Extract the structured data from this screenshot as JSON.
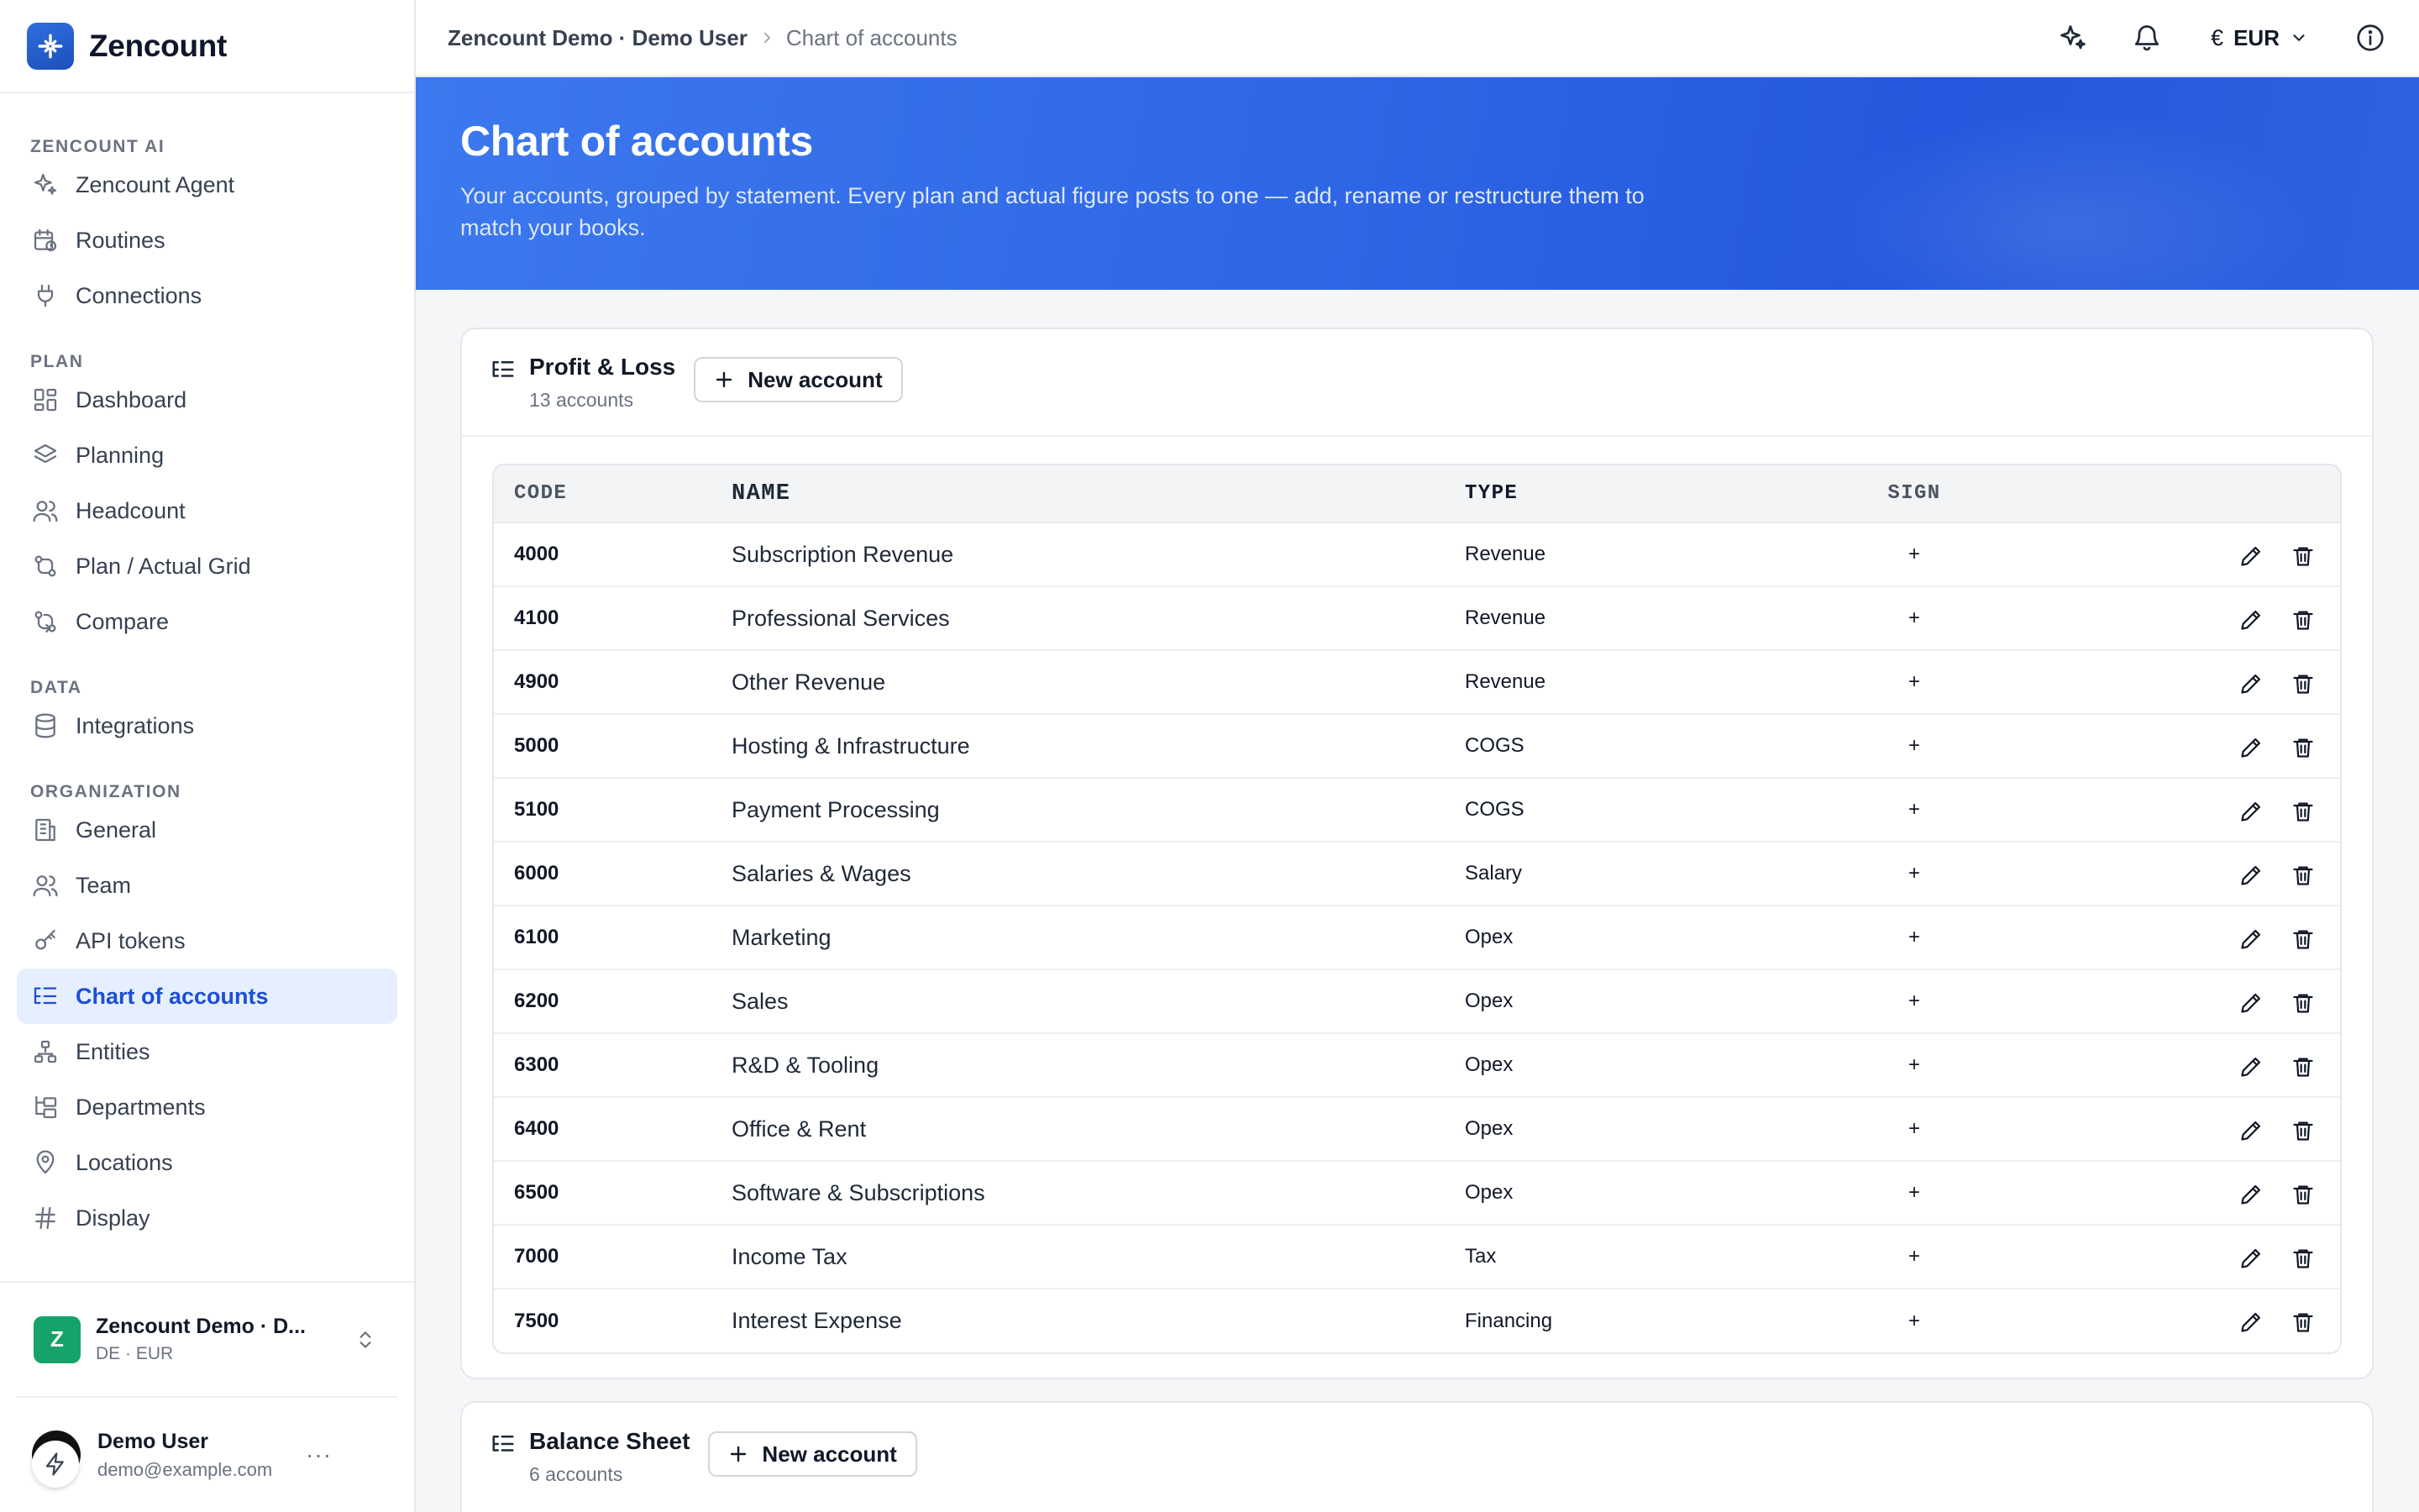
{
  "brand": {
    "name": "Zencount"
  },
  "sidebar": {
    "sections": [
      {
        "title": "ZENCOUNT AI",
        "items": [
          {
            "label": "Zencount Agent",
            "icon": "sparkles-icon"
          },
          {
            "label": "Routines",
            "icon": "calendar-clock-icon"
          },
          {
            "label": "Connections",
            "icon": "plug-icon"
          }
        ]
      },
      {
        "title": "PLAN",
        "items": [
          {
            "label": "Dashboard",
            "icon": "dashboard-icon"
          },
          {
            "label": "Planning",
            "icon": "layers-icon"
          },
          {
            "label": "Headcount",
            "icon": "users-icon"
          },
          {
            "label": "Plan / Actual Grid",
            "icon": "git-compare-icon"
          },
          {
            "label": "Compare",
            "icon": "compare-icon"
          }
        ]
      },
      {
        "title": "DATA",
        "items": [
          {
            "label": "Integrations",
            "icon": "database-icon"
          }
        ]
      },
      {
        "title": "ORGANIZATION",
        "items": [
          {
            "label": "General",
            "icon": "building-icon"
          },
          {
            "label": "Team",
            "icon": "team-icon"
          },
          {
            "label": "API tokens",
            "icon": "key-icon"
          },
          {
            "label": "Chart of accounts",
            "icon": "list-tree-icon",
            "active": true
          },
          {
            "label": "Entities",
            "icon": "network-icon"
          },
          {
            "label": "Departments",
            "icon": "folder-tree-icon"
          },
          {
            "label": "Locations",
            "icon": "map-pin-icon"
          },
          {
            "label": "Display",
            "icon": "hash-icon"
          }
        ]
      }
    ],
    "org": {
      "avatar_letter": "Z",
      "name": "Zencount Demo · D...",
      "sub": "DE · EUR"
    },
    "user": {
      "name": "Demo User",
      "email": "demo@example.com",
      "more": "···"
    }
  },
  "topbar": {
    "breadcrumb_org": "Zencount Demo · Demo User",
    "breadcrumb_page": "Chart of accounts",
    "currency_symbol": "€",
    "currency": "EUR"
  },
  "hero": {
    "title": "Chart of accounts",
    "subtitle": "Your accounts, grouped by statement. Every plan and actual figure posts to one — add, rename or restructure them to match your books."
  },
  "table_headers": {
    "code": "CODE",
    "name": "NAME",
    "type": "TYPE",
    "sign": "SIGN"
  },
  "pl_card": {
    "title": "Profit & Loss",
    "count": "13 accounts",
    "new_label": "New account",
    "rows": [
      {
        "code": "4000",
        "name": "Subscription Revenue",
        "type": "Revenue",
        "sign": "+"
      },
      {
        "code": "4100",
        "name": "Professional Services",
        "type": "Revenue",
        "sign": "+"
      },
      {
        "code": "4900",
        "name": "Other Revenue",
        "type": "Revenue",
        "sign": "+"
      },
      {
        "code": "5000",
        "name": "Hosting & Infrastructure",
        "type": "COGS",
        "sign": "+"
      },
      {
        "code": "5100",
        "name": "Payment Processing",
        "type": "COGS",
        "sign": "+"
      },
      {
        "code": "6000",
        "name": "Salaries & Wages",
        "type": "Salary",
        "sign": "+"
      },
      {
        "code": "6100",
        "name": "Marketing",
        "type": "Opex",
        "sign": "+"
      },
      {
        "code": "6200",
        "name": "Sales",
        "type": "Opex",
        "sign": "+"
      },
      {
        "code": "6300",
        "name": "R&D & Tooling",
        "type": "Opex",
        "sign": "+"
      },
      {
        "code": "6400",
        "name": "Office & Rent",
        "type": "Opex",
        "sign": "+"
      },
      {
        "code": "6500",
        "name": "Software & Subscriptions",
        "type": "Opex",
        "sign": "+"
      },
      {
        "code": "7000",
        "name": "Income Tax",
        "type": "Tax",
        "sign": "+"
      },
      {
        "code": "7500",
        "name": "Interest Expense",
        "type": "Financing",
        "sign": "+"
      }
    ]
  },
  "bs_card": {
    "title": "Balance Sheet",
    "count": "6 accounts",
    "new_label": "New account"
  },
  "colors": {
    "accent": "#2e67e6",
    "active_nav_bg": "#e6efff",
    "active_nav_text": "#1d4ed8",
    "org_avatar": "#16a36a"
  }
}
